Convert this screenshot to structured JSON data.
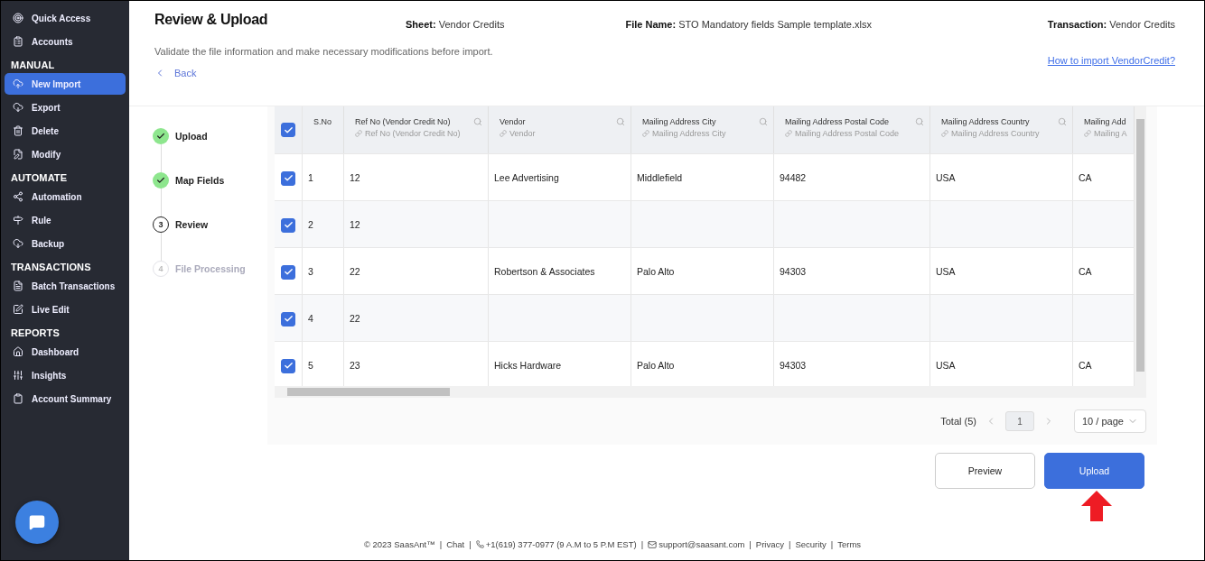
{
  "sidebar": {
    "sections": [
      {
        "items": [
          {
            "label": "Quick Access",
            "selected": false
          },
          {
            "label": "Accounts",
            "selected": false
          }
        ]
      },
      {
        "heading": "MANUAL",
        "items": [
          {
            "label": "New Import",
            "selected": true
          },
          {
            "label": "Export",
            "selected": false
          },
          {
            "label": "Delete",
            "selected": false
          },
          {
            "label": "Modify",
            "selected": false
          }
        ]
      },
      {
        "heading": "AUTOMATE",
        "items": [
          {
            "label": "Automation",
            "selected": false
          },
          {
            "label": "Rule",
            "selected": false
          },
          {
            "label": "Backup",
            "selected": false
          }
        ]
      },
      {
        "heading": "TRANSACTIONS",
        "items": [
          {
            "label": "Batch Transactions",
            "selected": false
          },
          {
            "label": "Live Edit",
            "selected": false
          }
        ]
      },
      {
        "heading": "REPORTS",
        "items": [
          {
            "label": "Dashboard",
            "selected": false
          },
          {
            "label": "Insights",
            "selected": false
          },
          {
            "label": "Account Summary",
            "selected": false
          }
        ]
      }
    ]
  },
  "header": {
    "title": "Review & Upload",
    "meta": [
      {
        "label": "Sheet:",
        "value": "Vendor Credits"
      },
      {
        "label": "File Name:",
        "value": "STO Mandatory fields Sample template.xlsx"
      },
      {
        "label": "Transaction:",
        "value": "Vendor Credits"
      }
    ],
    "subtitle": "Validate the file information and make necessary modifications before import.",
    "back": "Back",
    "help_link": "How to import VendorCredit?"
  },
  "steps": [
    {
      "label": "Upload",
      "completed": true,
      "current": false
    },
    {
      "label": "Map Fields",
      "completed": true,
      "current": false
    },
    {
      "number": "3",
      "label": "Review",
      "completed": false,
      "current": true
    },
    {
      "number": "4",
      "label": "File Processing",
      "completed": false,
      "current": false
    }
  ],
  "table": {
    "all_checked": true,
    "columns": [
      {
        "label": "S.No"
      },
      {
        "label": "Ref No (Vendor Credit No)",
        "mapped": "Ref No (Vendor Credit No)"
      },
      {
        "label": "Vendor",
        "mapped": "Vendor"
      },
      {
        "label": "Mailing Address City",
        "mapped": "Mailing Address City"
      },
      {
        "label": "Mailing Address Postal Code",
        "mapped": "Mailing Address Postal Code"
      },
      {
        "label": "Mailing Address Country",
        "mapped": "Mailing Address Country"
      },
      {
        "label": "Mailing Add",
        "mapped": "Mailing A"
      }
    ],
    "rows": [
      {
        "checked": true,
        "cells": [
          "1",
          "12",
          "Lee Advertising",
          "Middlefield",
          "94482",
          "USA",
          "CA"
        ]
      },
      {
        "checked": true,
        "cells": [
          "2",
          "12",
          "",
          "",
          "",
          "",
          ""
        ]
      },
      {
        "checked": true,
        "cells": [
          "3",
          "22",
          "Robertson & Associates",
          "Palo Alto",
          "94303",
          "USA",
          "CA"
        ]
      },
      {
        "checked": true,
        "cells": [
          "4",
          "22",
          "",
          "",
          "",
          "",
          ""
        ]
      },
      {
        "checked": true,
        "cells": [
          "5",
          "23",
          "Hicks Hardware",
          "Palo Alto",
          "94303",
          "USA",
          "CA"
        ]
      }
    ]
  },
  "pagination": {
    "total": "Total (5)",
    "page": "1",
    "page_size": "10 / page"
  },
  "buttons": {
    "preview": "Preview",
    "upload": "Upload"
  },
  "footer": {
    "separator": "|",
    "items": [
      {
        "kind": "text",
        "text": "© 2023 SaasAnt™"
      },
      {
        "kind": "link",
        "text": "Chat"
      },
      {
        "kind": "phone",
        "text": "+1(619) 377-0977 (9 A.M to 5 P.M EST)"
      },
      {
        "kind": "email",
        "text": "support@saasant.com"
      },
      {
        "kind": "link",
        "text": "Privacy"
      },
      {
        "kind": "link",
        "text": "Security"
      },
      {
        "kind": "link",
        "text": "Terms"
      }
    ]
  }
}
